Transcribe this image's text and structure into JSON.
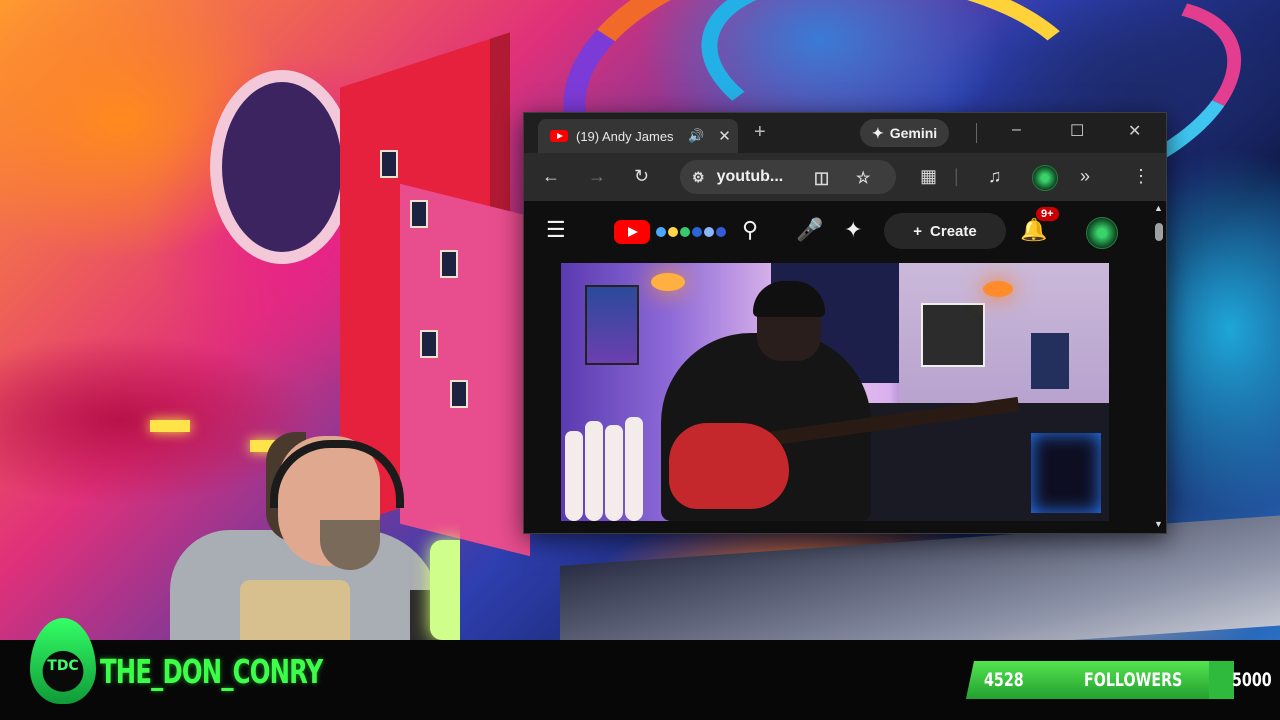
{
  "browser": {
    "tab": {
      "title": "(19) Andy James",
      "audio_icon": "speaker-icon"
    },
    "new_tab_glyph": "+",
    "gemini_label": "Gemini",
    "window_controls": {
      "minimize": "–",
      "maximize": "☐",
      "close": "✕"
    },
    "toolbar": {
      "omnibox_text": "youtub..."
    }
  },
  "youtube": {
    "create_label": "Create",
    "notification_badge": "9+"
  },
  "overlay": {
    "logo_text": "TDC",
    "channel_name": "THE_DON_CONRY",
    "followers": {
      "current": "4528",
      "label": "FOLLOWERS",
      "goal": "5000",
      "progress": 0.9056
    }
  },
  "colors": {
    "channel_green": "#3cff4a",
    "progress_green": "#2fba3e",
    "youtube_red": "#ff0000"
  }
}
